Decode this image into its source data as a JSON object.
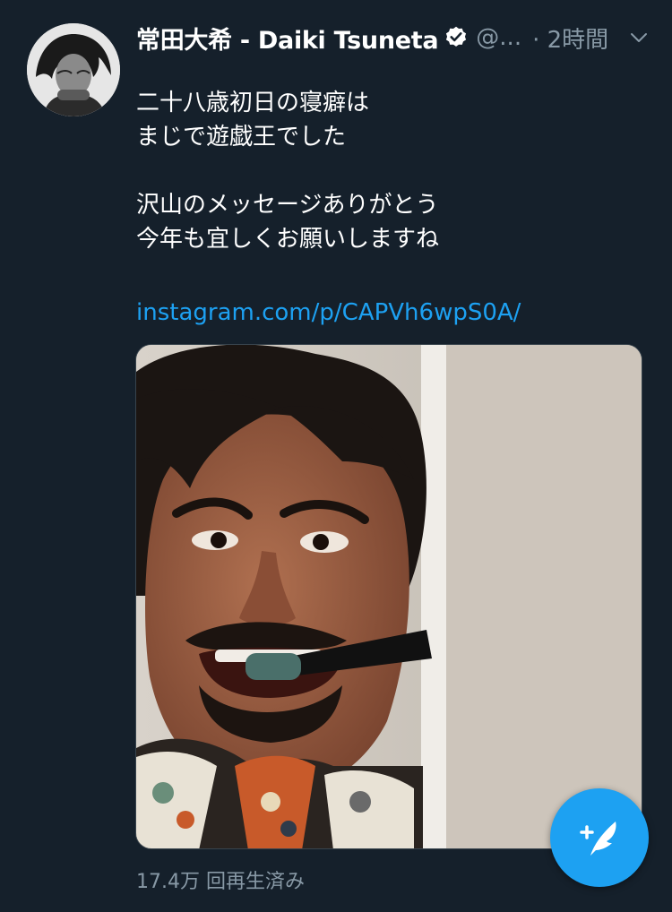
{
  "tweet": {
    "display_name": "常田大希 - Daiki Tsuneta",
    "handle": "@...",
    "time": "· 2時間",
    "text_lines": [
      "二十八歳初日の寝癖は",
      "まじで遊戯王でした",
      "",
      "沢山のメッセージありがとう",
      "今年も宜しくお願いしますね"
    ],
    "link": "instagram.com/p/CAPVh6wpS0A/",
    "views": "17.4万 回再生済み"
  },
  "colors": {
    "background": "#15202b",
    "text": "#ffffff",
    "secondary": "#8899a6",
    "accent": "#1da1f2"
  },
  "icons": {
    "verified": "verified-badge-icon",
    "more": "chevron-down-icon",
    "compose": "compose-tweet-icon"
  }
}
